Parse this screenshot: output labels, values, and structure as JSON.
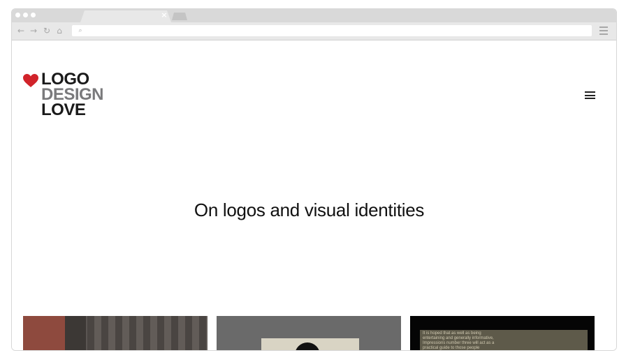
{
  "browser": {
    "tab_close_glyph": "×",
    "address_bar": {
      "url": ""
    },
    "nav_icons": [
      "back-arrow-icon",
      "forward-arrow-icon",
      "reload-icon",
      "home-icon"
    ]
  },
  "site": {
    "logo": {
      "line1": "LOGO",
      "line2": "DESIGN",
      "line3": "LOVE",
      "heart_color": "#d1232a",
      "dark_color": "#1a1a1a",
      "gray_color": "#7a7a7c"
    },
    "tagline": "On logos and visual identities",
    "menu_icon": "hamburger-menu-icon",
    "thumbnails": [
      {
        "name": "post-thumbnail-1"
      },
      {
        "name": "post-thumbnail-2"
      },
      {
        "name": "post-thumbnail-3",
        "excerpt": "It is hoped that as well as being entertaining and generally informative, Impressions number three will act as a practical guide to those people responsible for the"
      }
    ]
  }
}
